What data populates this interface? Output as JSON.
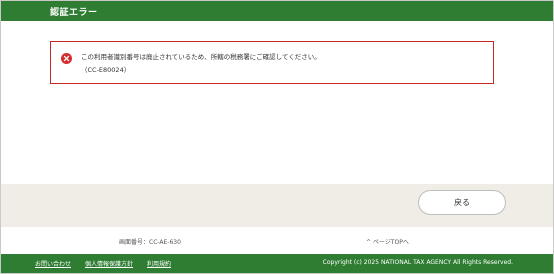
{
  "header": {
    "title": "認証エラー"
  },
  "error": {
    "message": "この利用者識別番号は廃止されているため、所轄の税務署にご確認してください。",
    "code": "（CC-E80024）"
  },
  "actions": {
    "back_label": "戻る"
  },
  "info": {
    "screen_id": "画面番号：CC-AE-630",
    "page_top": "^ ページTOPへ"
  },
  "footer": {
    "links": [
      "お問い合わせ",
      "個人情報保護方針",
      "利用規約"
    ],
    "copyright": "Copyright (c) 2025 NATIONAL TAX AGENCY All Rights Reserved."
  },
  "colors": {
    "brand_green": "#2e7d32",
    "error_red": "#c62828",
    "band_beige": "#efede6"
  },
  "icons": {
    "error": "error-circle-icon"
  }
}
